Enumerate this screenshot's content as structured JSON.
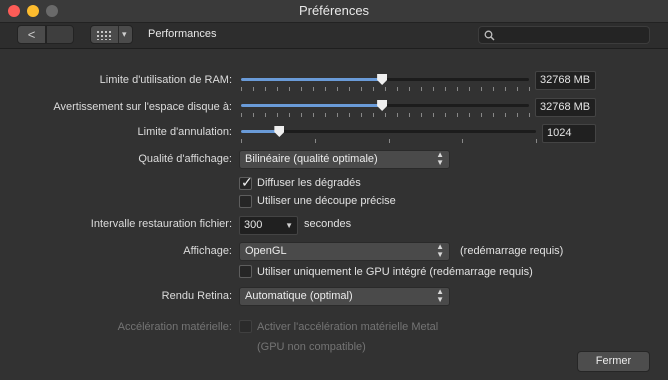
{
  "window": {
    "title": "Préférences"
  },
  "toolbar": {
    "back_glyph": "<",
    "section_title": "Performances",
    "grid_caret": "▾",
    "search_placeholder": "",
    "icons": [
      "back-icon",
      "grid-icon",
      "search-icon"
    ]
  },
  "settings": {
    "ram": {
      "label": "Limite d'utilisation de RAM:",
      "value": "32768 MB",
      "slider_fraction": 0.49
    },
    "disk": {
      "label": "Avertissement sur l'espace disque à:",
      "value": "32768 MB",
      "slider_fraction": 0.49
    },
    "undo": {
      "label": "Limite d'annulation:",
      "value": "1024",
      "slider_fraction": 0.13
    },
    "quality": {
      "label": "Qualité d'affichage:",
      "value": "Bilinéaire (qualité optimale)"
    },
    "gradients": {
      "label": "Diffuser les dégradés",
      "checked": true
    },
    "precise_clip": {
      "label": "Utiliser une découpe précise",
      "checked": false
    },
    "restore": {
      "label": "Intervalle restauration fichier:",
      "value": "300",
      "unit": "secondes"
    },
    "display": {
      "label": "Affichage:",
      "value": "OpenGL",
      "note": "(redémarrage requis)"
    },
    "integrated_gpu": {
      "label": "Utiliser uniquement le GPU intégré (redémarrage requis)",
      "checked": false
    },
    "retina": {
      "label": "Rendu Retina:",
      "value": "Automatique (optimal)"
    },
    "hw_accel": {
      "label": "Accélération matérielle:",
      "checkbox_label": "Activer l'accélération matérielle Metal",
      "note": "(GPU non compatible)",
      "checked": false,
      "enabled": false
    }
  },
  "footer": {
    "close_label": "Fermer"
  },
  "colors": {
    "accent": "#6a9bd8",
    "background": "#323232"
  }
}
